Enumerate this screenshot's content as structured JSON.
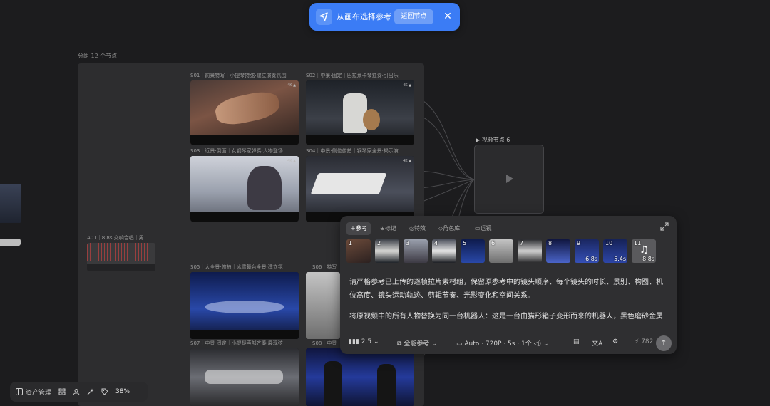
{
  "banner": {
    "title": "从画布选择参考",
    "back_label": "返回节点",
    "close_glyph": "✕"
  },
  "group": {
    "label": "分组 12 个节点"
  },
  "clips": [
    {
      "title": "S01｜前景特写｜小提琴持弦·建立演奏氛围"
    },
    {
      "title": "S02｜中景·固定｜巴拉莱卡琴独奏·引出乐"
    },
    {
      "title": "S03｜近景·倒面｜女钢琴家弹奏·人物登场"
    },
    {
      "title": "S04｜中景·侧位俯拍｜钢琴家全景·揭示演"
    },
    {
      "title": "S05｜大全景·俯拍｜冰雪舞台全景·建立氛"
    },
    {
      "title": "S06｜特写"
    },
    {
      "title": "S07｜中景·固定｜小提琴声部齐奏·展现弦"
    },
    {
      "title": "S08｜中景"
    }
  ],
  "video_node": {
    "label": "视频节点 6"
  },
  "audio_node": {
    "label": "A01｜8.8s 交响合唱｜男"
  },
  "toolbar": {
    "assets_label": "资产管理",
    "zoom": "38%"
  },
  "panel": {
    "tabs": [
      {
        "label": "参考",
        "icon": "plus-icon"
      },
      {
        "label": "标记",
        "icon": "mark-icon"
      },
      {
        "label": "特效",
        "icon": "camera-icon"
      },
      {
        "label": "角色库",
        "icon": "shield-icon"
      },
      {
        "label": "运镜",
        "icon": "video-icon"
      }
    ],
    "thumbs": [
      {
        "num": "1",
        "dur": ""
      },
      {
        "num": "2",
        "dur": ""
      },
      {
        "num": "3",
        "dur": ""
      },
      {
        "num": "4",
        "dur": ""
      },
      {
        "num": "5",
        "dur": ""
      },
      {
        "num": "6",
        "dur": ""
      },
      {
        "num": "7",
        "dur": ""
      },
      {
        "num": "8",
        "dur": ""
      },
      {
        "num": "9",
        "dur": "6.8s"
      },
      {
        "num": "10",
        "dur": "5.4s"
      },
      {
        "num": "11",
        "dur": "8.8s"
      }
    ],
    "prompt_para1": "请严格参考已上传的逐帧拉片素材组，保留原参考中的镜头顺序、每个镜头的时长、景别、构图、机位高度、镜头运动轨迹、剪辑节奏、光影变化和空间关系。",
    "prompt_para2": "将原视频中的所有人物替换为同一台机器人：这是一台由猫形箱子变形而来的机器人，黑色磨砂金属",
    "model_version": "2.5",
    "mode_label": "全能参考",
    "settings": "Auto · 720P · 5s · 1个",
    "credits": "782"
  },
  "colors": {
    "accent": "#3b7cf5",
    "background": "#1c1c1e"
  }
}
